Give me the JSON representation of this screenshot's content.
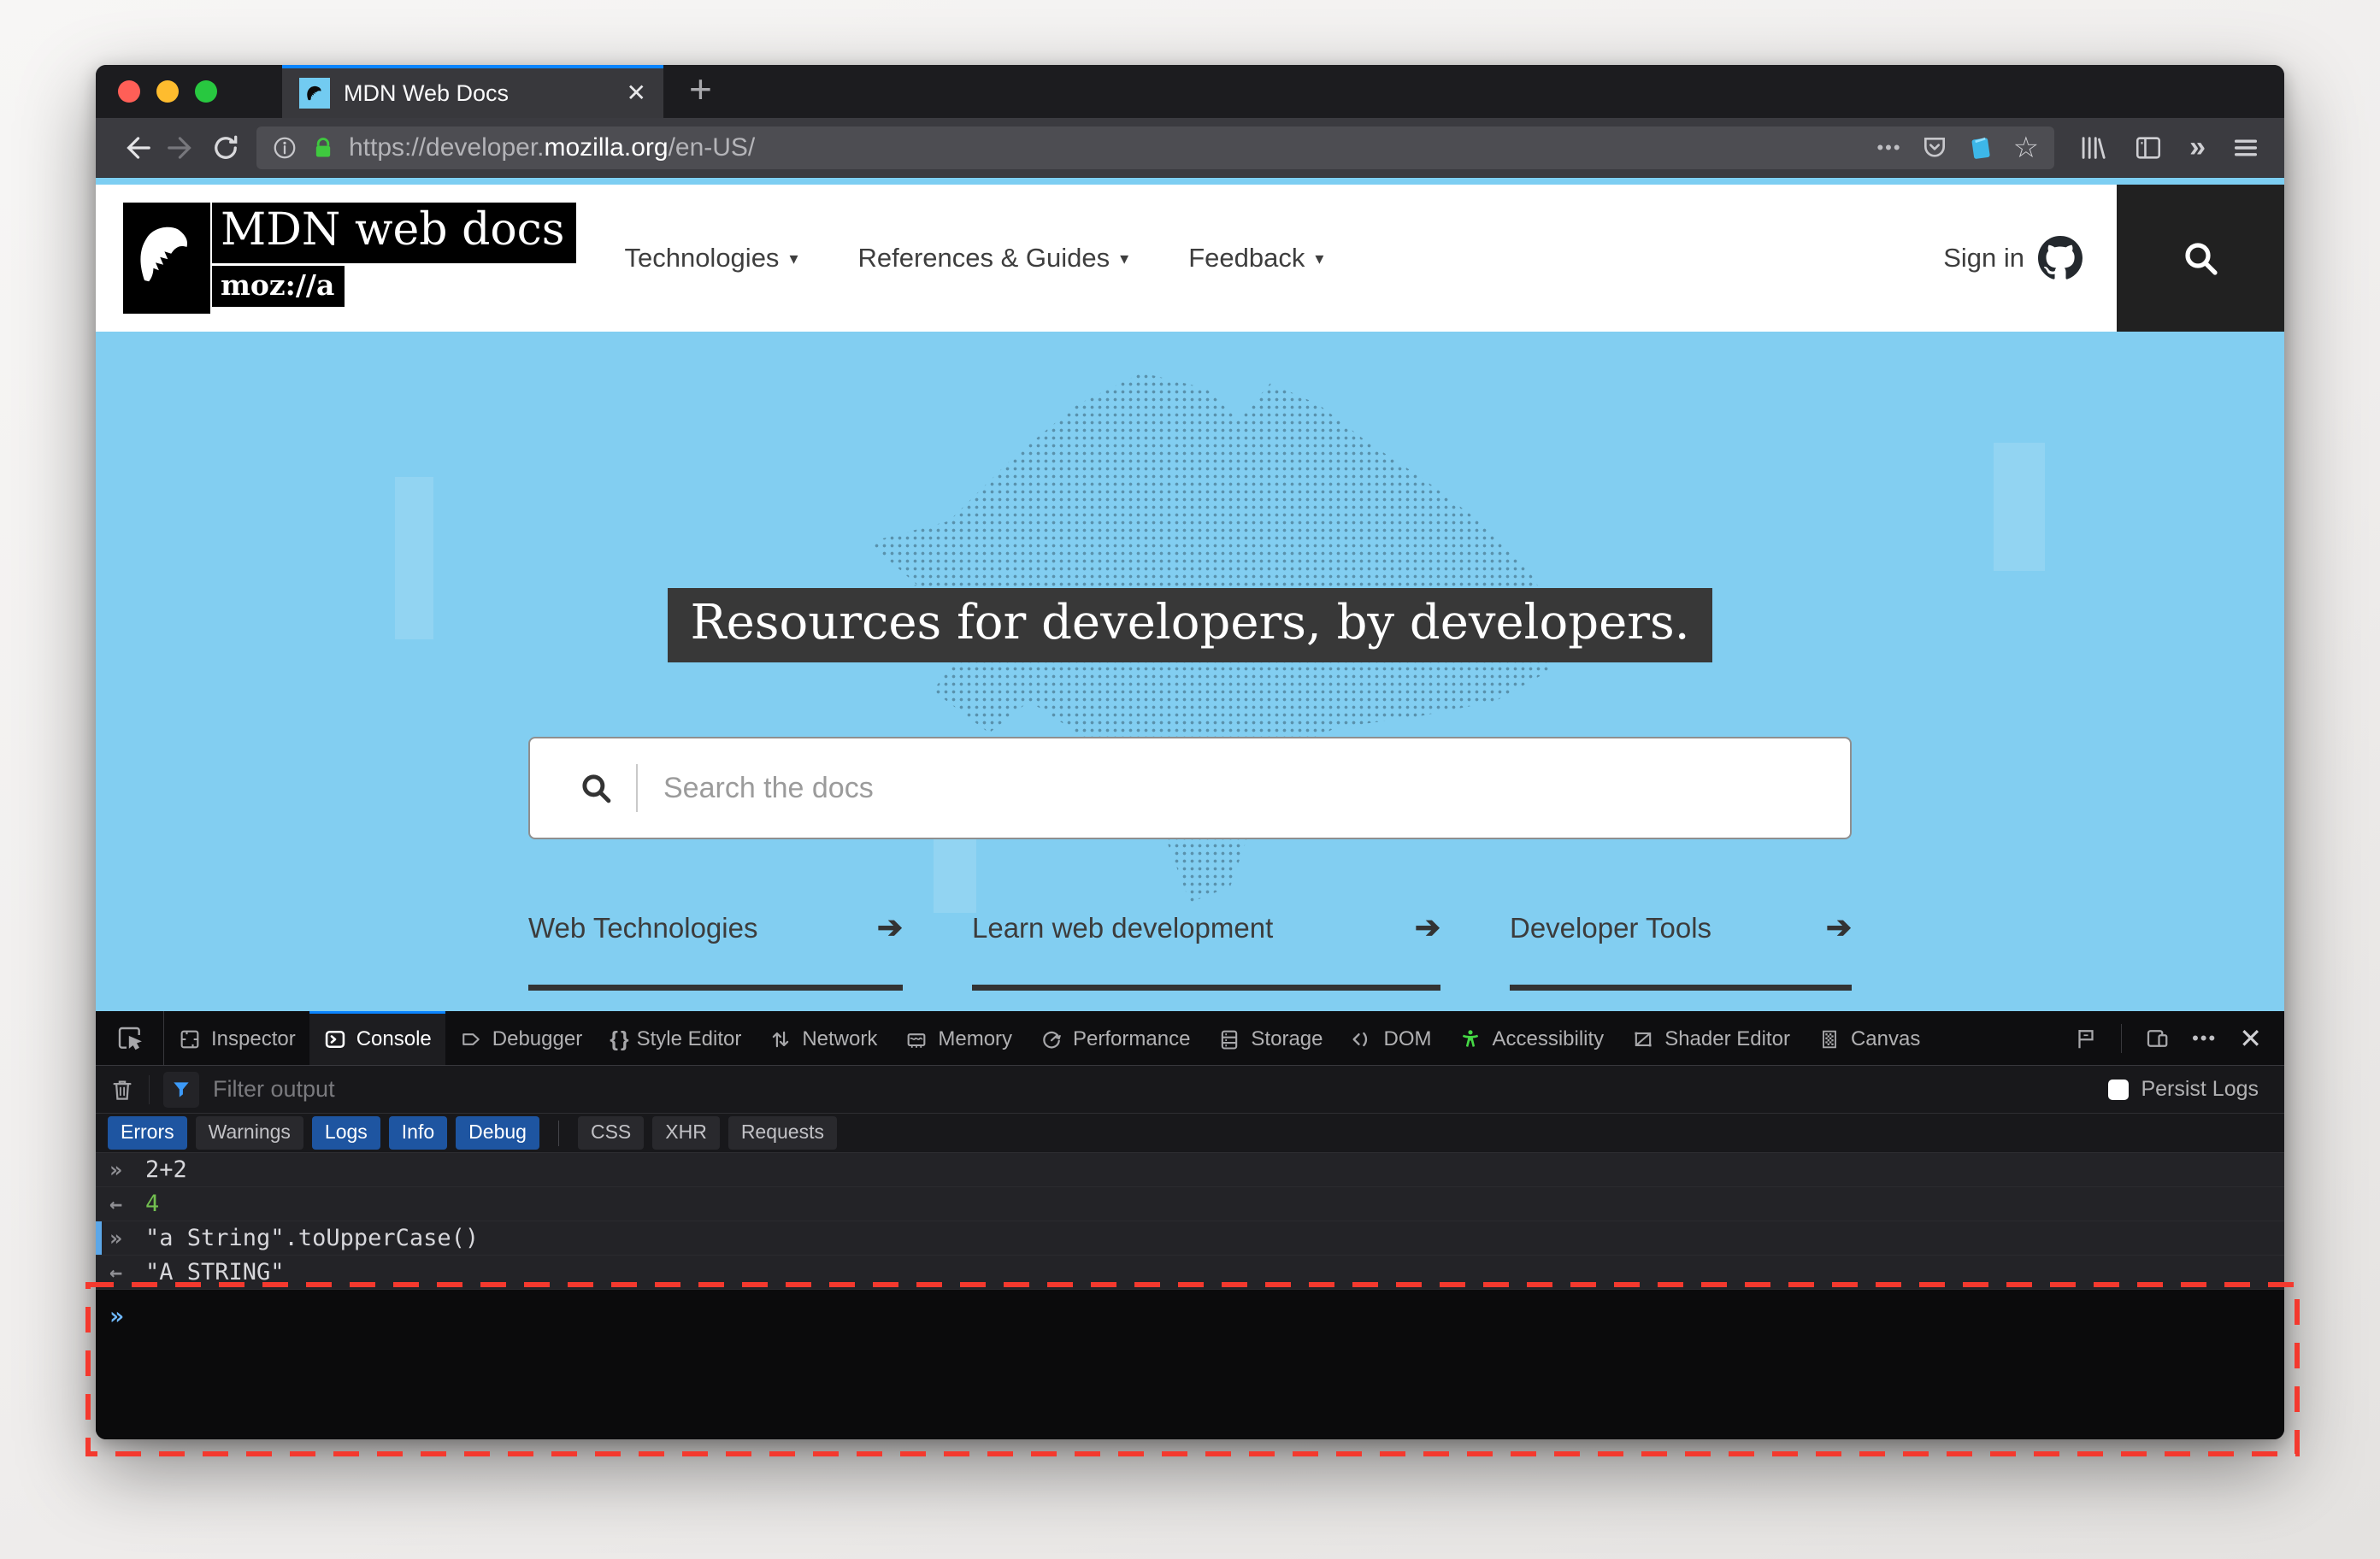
{
  "icons": {
    "close": "✕",
    "plus": "+",
    "star": "☆",
    "meatballs": "•••",
    "overflow": "»",
    "caret_down": "▾",
    "braces": "{ }",
    "arrow_right": "➔",
    "input_marker": "»",
    "result_marker": "←"
  },
  "browser": {
    "tab_title": "MDN Web Docs",
    "url_prefix": "https://developer.",
    "url_domain": "mozilla.org",
    "url_suffix": "/en-US/",
    "accent_blue": "#0a84ff"
  },
  "mdn": {
    "logo_title": "MDN web docs",
    "logo_sub": "moz://a",
    "nav": [
      {
        "label": "Technologies"
      },
      {
        "label": "References & Guides"
      },
      {
        "label": "Feedback"
      }
    ],
    "sign_in": "Sign in",
    "hero": {
      "headline": "Resources for developers, by developers.",
      "search_placeholder": "Search the docs",
      "links": [
        {
          "label": "Web Technologies"
        },
        {
          "label": "Learn web development"
        },
        {
          "label": "Developer Tools"
        }
      ],
      "bg_color": "#82cef1"
    }
  },
  "devtools": {
    "tabs": [
      {
        "label": "Inspector",
        "active": false
      },
      {
        "label": "Console",
        "active": true
      },
      {
        "label": "Debugger",
        "active": false
      },
      {
        "label": "Style Editor",
        "active": false
      },
      {
        "label": "Network",
        "active": false
      },
      {
        "label": "Memory",
        "active": false
      },
      {
        "label": "Performance",
        "active": false
      },
      {
        "label": "Storage",
        "active": false
      },
      {
        "label": "DOM",
        "active": false
      },
      {
        "label": "Accessibility",
        "active": false
      },
      {
        "label": "Shader Editor",
        "active": false
      },
      {
        "label": "Canvas",
        "active": false
      }
    ],
    "filter_placeholder": "Filter output",
    "persist_label": "Persist Logs",
    "filters": [
      {
        "label": "Errors",
        "active": true
      },
      {
        "label": "Warnings",
        "active": false
      },
      {
        "label": "Logs",
        "active": true
      },
      {
        "label": "Info",
        "active": true
      },
      {
        "label": "Debug",
        "active": true
      },
      {
        "label": "CSS",
        "active": false
      },
      {
        "label": "XHR",
        "active": false
      },
      {
        "label": "Requests",
        "active": false
      }
    ],
    "log": [
      {
        "marker": "»",
        "text": "2+2",
        "kind": "input"
      },
      {
        "marker": "←",
        "text": "4",
        "kind": "result-number"
      },
      {
        "marker": "»",
        "text": "\"a String\".toUpperCase()",
        "kind": "input",
        "selected": true
      },
      {
        "marker": "←",
        "text": "\"A STRING\"",
        "kind": "result"
      }
    ],
    "result_number_color": "#72bf50"
  },
  "highlight": {
    "color": "#f4392e"
  }
}
